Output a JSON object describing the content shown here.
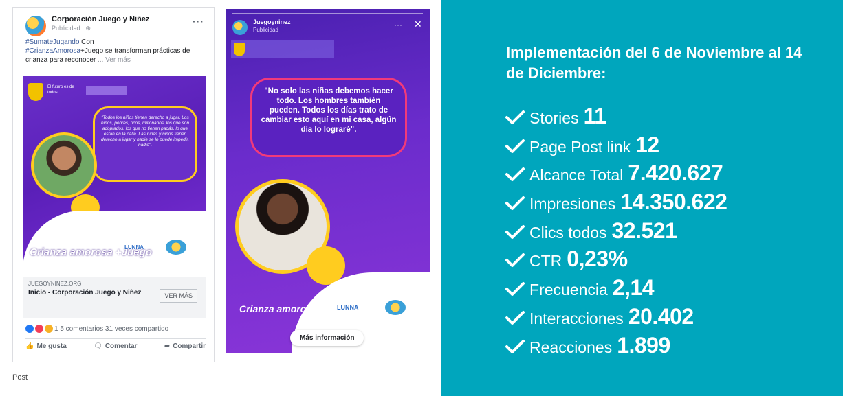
{
  "fb_post": {
    "page_name": "Corporación Juego y Niñez",
    "sponsored": "Publicidad · ⊕",
    "more": "···",
    "text_tag1": "#SumateJugando",
    "text_plain1": " Con",
    "text_tag2": "#CrianzaAmorosa",
    "text_plain2": "+Juego se transforman prácticas de crianza para reconocer",
    "text_more": " ... Ver más",
    "creative_quote": "\"Todos los niños tienen derecho a jugar. Los niños, pobres, ricos, millonarios, los que son adoptados, los que no tienen papás, lo que están en la calle. Las niñas y niños tienen derecho a jugar y nadie se lo puede impedir, nadie\".",
    "creative_gov": "El futuro es de todos",
    "creative_brand": "Crianza amorosa +Juego",
    "creative_lunna": "LUNNA",
    "link_domain": "JUEGOYNINEZ.ORG",
    "link_title": "Inicio - Corporación Juego y Niñez",
    "link_cta": "VER MÁS",
    "reactions_text": "1  5 comentarios  31 veces compartido",
    "action_like": "Me gusta",
    "action_comment": "Comentar",
    "action_share": "Compartir"
  },
  "caption": "Post",
  "story": {
    "name": "Juegoyninez",
    "sponsored": "Publicidad",
    "dots": "···",
    "close": "✕",
    "quote": "\"No solo las niñas debemos hacer todo. Los hombres también pueden. Todos los días trato de cambiar esto aquí en mi casa, algún día lo lograré\".",
    "brand": "Crianza amorosa +Juego",
    "lunna": "LUNNA",
    "cta": "Más información"
  },
  "panel": {
    "background": "#00a6bd",
    "title": "Implementación del 6 de Noviembre al 14 de Diciembre:",
    "metrics": [
      {
        "label": "Stories",
        "value": "11"
      },
      {
        "label": "Page Post link",
        "value": "12"
      },
      {
        "label": "Alcance Total",
        "value": "7.420.627"
      },
      {
        "label": "Impresiones",
        "value": "14.350.622"
      },
      {
        "label": "Clics todos",
        "value": "32.521"
      },
      {
        "label": "CTR",
        "value": "0,23%"
      },
      {
        "label": "Frecuencia",
        "value": "2,14"
      },
      {
        "label": "Interacciones",
        "value": "20.402"
      },
      {
        "label": "Reacciones",
        "value": "1.899"
      }
    ]
  }
}
